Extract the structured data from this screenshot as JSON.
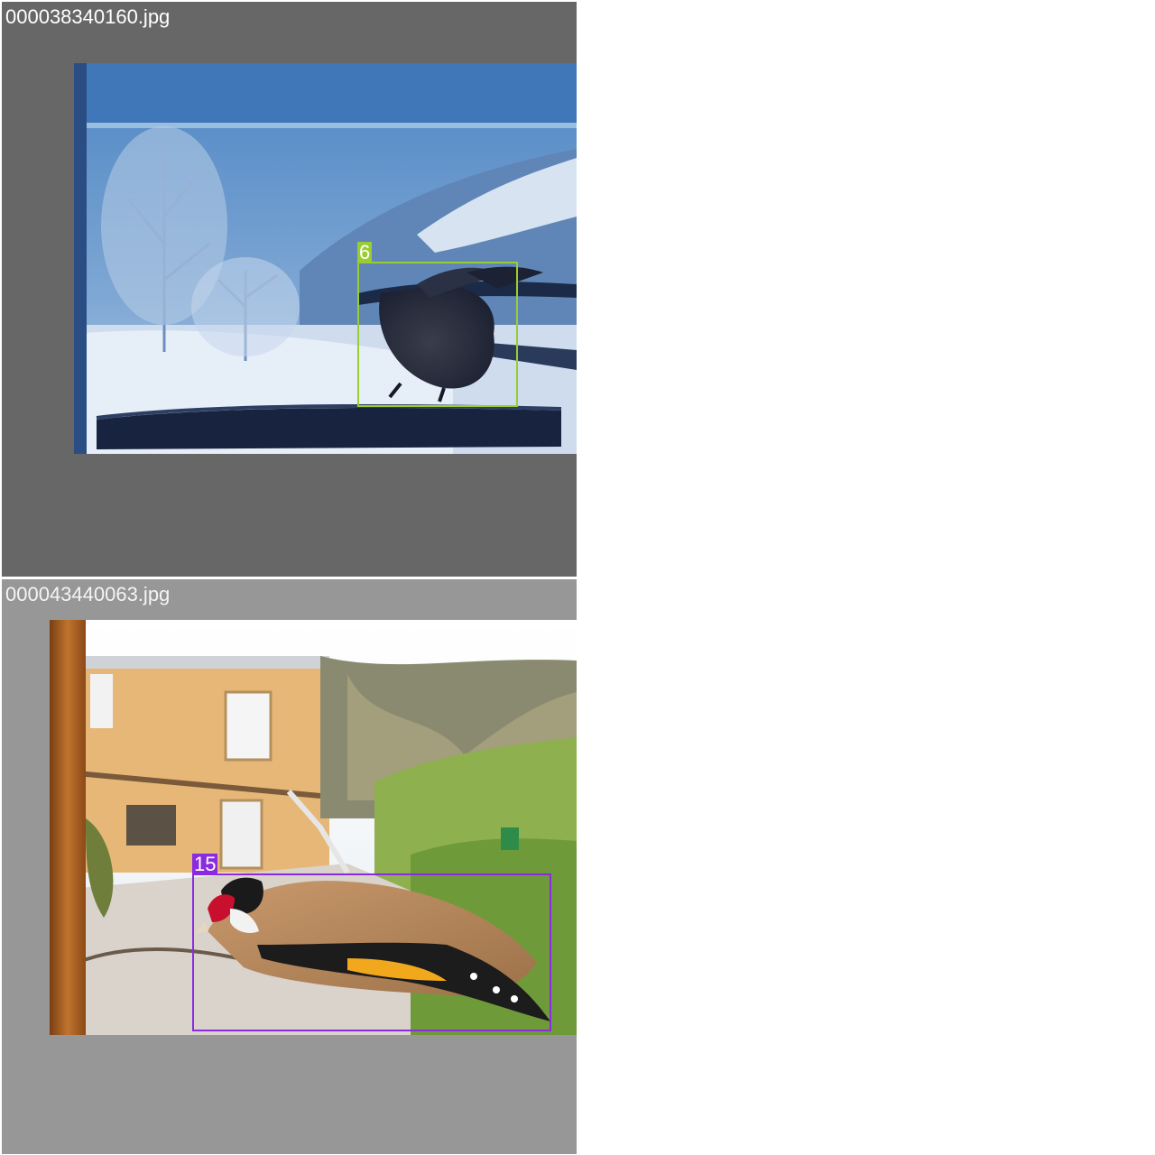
{
  "tiles": [
    {
      "filename": "000038340160.jpg",
      "photo": "winter bird feeder scene with bird",
      "detection": {
        "label": "6",
        "color": "#9acd32"
      }
    },
    {
      "filename": "000043440063.jpg",
      "photo": "goldfinch on feeder in sunny garden",
      "detection": {
        "label": "15",
        "color": "#8a2be2"
      }
    }
  ],
  "colors": {
    "tile1_background": "#676767",
    "tile2_background": "#979797",
    "page_background": "#ffffff"
  }
}
